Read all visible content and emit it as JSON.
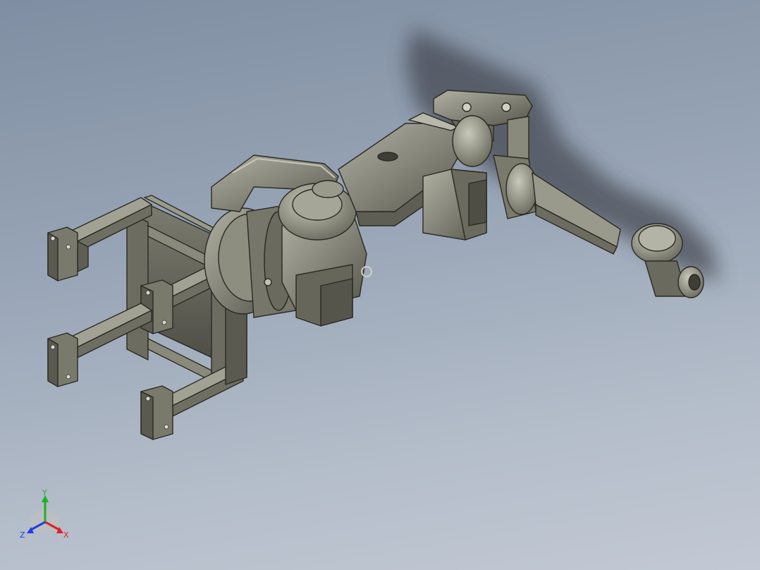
{
  "viewport": {
    "description_visible": false,
    "background_top": "#7f8ea2",
    "background_bottom": "#c2c9d4",
    "model_color": "#7a7a6c",
    "model_highlight": "#a8a89a",
    "model_shadow": "#4e4e44"
  },
  "triad": {
    "x_label": "X",
    "y_label": "Y",
    "z_label": "Z",
    "x_color": "#e02020",
    "y_color": "#20b020",
    "z_color": "#2040e0"
  }
}
